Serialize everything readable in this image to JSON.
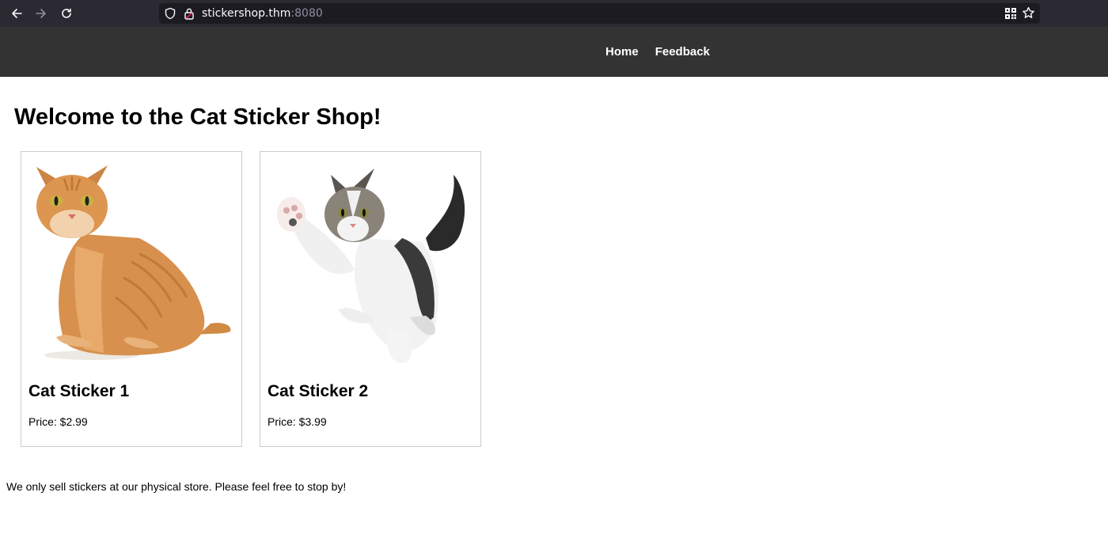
{
  "browser": {
    "url_host": "stickershop.thm",
    "url_port": ":8080",
    "icons": [
      "back-arrow-icon",
      "forward-arrow-icon",
      "reload-icon",
      "shield-icon",
      "lock-icon",
      "qr-code-icon",
      "bookmark-star-icon"
    ]
  },
  "site": {
    "nav": [
      {
        "label": "Home"
      },
      {
        "label": "Feedback"
      }
    ],
    "title": "Welcome to the Cat Sticker Shop!",
    "products": [
      {
        "name": "Cat Sticker 1",
        "price": "Price: $2.99",
        "image": "orange-tabby-cat-image"
      },
      {
        "name": "Cat Sticker 2",
        "price": "Price: $3.99",
        "image": "waving-kitten-image"
      }
    ],
    "footer_note": "We only sell stickers at our physical store. Please feel free to stop by!"
  },
  "colors": {
    "header_bg": "#333333",
    "browser_bg": "#2b2a33",
    "card_border": "#cccccc"
  }
}
